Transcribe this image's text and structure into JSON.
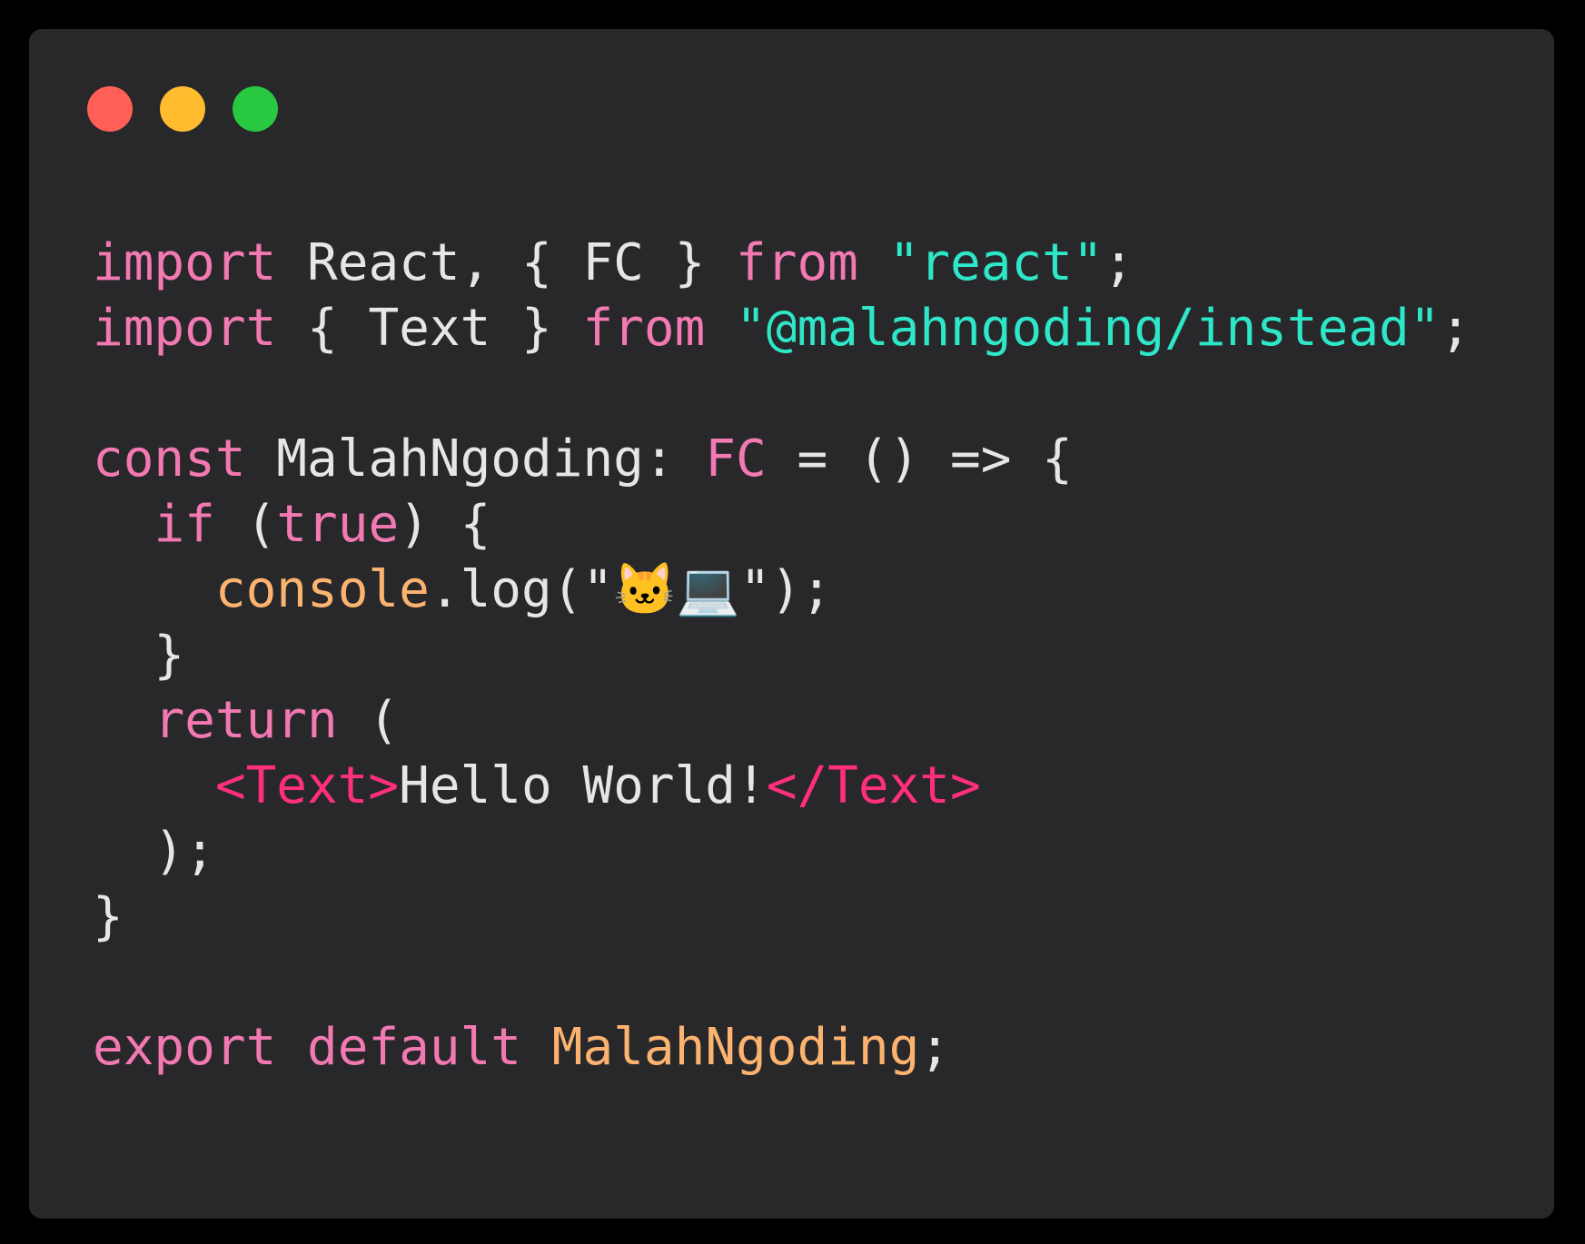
{
  "window": {
    "controls": {
      "close_color": "#ff5f57",
      "minimize_color": "#febc2e",
      "maximize_color": "#28c840"
    }
  },
  "theme": {
    "background": "#28282b",
    "keyword": "#f279b1",
    "string": "#2ee6c8",
    "function": "#fcb36f",
    "tag": "#ff2f7a",
    "text": "#e6e6e6"
  },
  "code": {
    "l1": {
      "kw_import": "import",
      "t1": " React, { FC } ",
      "kw_from": "from",
      "sp": " ",
      "str": "\"react\"",
      "semi": ";"
    },
    "l2": {
      "kw_import": "import",
      "t1": " { Text } ",
      "kw_from": "from",
      "sp": " ",
      "str": "\"@malahngoding/instead\"",
      "semi": ";"
    },
    "l4": {
      "kw_const": "const",
      "t1": " MalahNgoding: ",
      "kw_fc": "FC",
      "t2": " = () => {"
    },
    "l5": {
      "indent": "  ",
      "kw_if": "if",
      "t1": " (",
      "kw_true": "true",
      "t2": ") {"
    },
    "l6": {
      "indent": "    ",
      "fn_console": "console",
      "t1": ".log(\"🐱💻\");"
    },
    "l7": {
      "t1": "  }"
    },
    "l8": {
      "indent": "  ",
      "kw_return": "return",
      "t1": " ("
    },
    "l9": {
      "indent": "    ",
      "tag_open": "<Text>",
      "t1": "Hello World!",
      "tag_close": "</Text>"
    },
    "l10": {
      "t1": "  );"
    },
    "l11": {
      "t1": "}"
    },
    "l13": {
      "kw_export": "export",
      "sp": " ",
      "kw_default": "default",
      "sp2": " ",
      "fn_name": "MalahNgoding",
      "semi": ";"
    }
  }
}
